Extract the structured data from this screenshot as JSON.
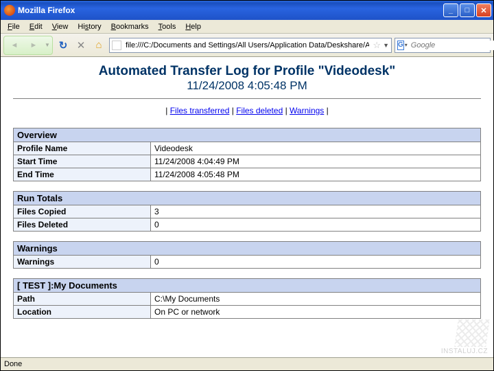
{
  "window": {
    "title": "Mozilla Firefox"
  },
  "menus": [
    "File",
    "Edit",
    "View",
    "History",
    "Bookmarks",
    "Tools",
    "Help"
  ],
  "url": "file:///C:/Documents and Settings/All Users/Application Data/Deskshare/Au",
  "search_placeholder": "Google",
  "report": {
    "title": "Automated Transfer Log for Profile \"Videodesk\"",
    "subtitle": "11/24/2008 4:05:48 PM",
    "links": [
      "Files transferred",
      "Files deleted",
      "Warnings"
    ],
    "overview": {
      "heading": "Overview",
      "rows": [
        {
          "label": "Profile Name",
          "value": "Videodesk"
        },
        {
          "label": "Start Time",
          "value": "11/24/2008 4:04:49 PM"
        },
        {
          "label": "End Time",
          "value": "11/24/2008 4:05:48 PM"
        }
      ]
    },
    "run_totals": {
      "heading": "Run Totals",
      "rows": [
        {
          "label": "Files Copied",
          "value": "3"
        },
        {
          "label": "Files Deleted",
          "value": "0"
        }
      ]
    },
    "warnings": {
      "heading": "Warnings",
      "rows": [
        {
          "label": "Warnings",
          "value": "0"
        }
      ]
    },
    "test": {
      "heading": "[ TEST  ]:My Documents",
      "rows": [
        {
          "label": "Path",
          "value": "C:\\My Documents"
        },
        {
          "label": "Location",
          "value": "On PC or network"
        }
      ]
    }
  },
  "status": "Done",
  "watermark": "INSTALUJ.CZ"
}
